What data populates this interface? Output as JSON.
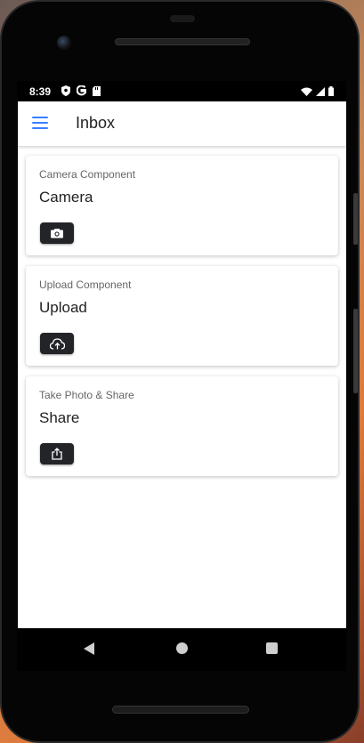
{
  "status_bar": {
    "time": "8:39",
    "left_icons": [
      "shield-icon",
      "google-g-icon",
      "sd-card-icon"
    ],
    "right_icons": [
      "wifi-icon",
      "signal-icon",
      "battery-icon"
    ]
  },
  "toolbar": {
    "title": "Inbox",
    "menu_icon": "menu-icon",
    "accent_color": "#3880ff"
  },
  "cards": [
    {
      "subtitle": "Camera Component",
      "title": "Camera",
      "button_icon": "camera-icon"
    },
    {
      "subtitle": "Upload Component",
      "title": "Upload",
      "button_icon": "cloud-upload-icon"
    },
    {
      "subtitle": "Take Photo & Share",
      "title": "Share",
      "button_icon": "share-icon"
    }
  ],
  "nav_bar": {
    "buttons": [
      "back-icon",
      "home-icon",
      "recents-icon"
    ]
  },
  "colors": {
    "button_bg": "#222428",
    "app_bg": "#ffffff"
  }
}
